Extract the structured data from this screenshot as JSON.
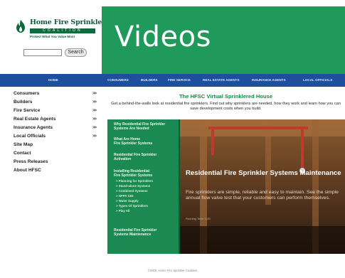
{
  "logo": {
    "title": "Home Fire Sprinkler",
    "coalition": "COALITION",
    "tagline": "Protect What You Value Most"
  },
  "search": {
    "placeholder": "",
    "button_label": "Search"
  },
  "header": {
    "title": "Videos"
  },
  "nav": {
    "items": [
      "HOME",
      "CONSUMERS",
      "BUILDERS",
      "FIRE SERVICE",
      "REAL ESTATE AGENTS",
      "INSURANCE AGENTS",
      "LOCAL OFFICIALS"
    ]
  },
  "sidebar": {
    "arrow": ">>",
    "items": [
      {
        "label": "Consumers"
      },
      {
        "label": "Builders"
      },
      {
        "label": "Fire Service"
      },
      {
        "label": "Real Estate Agents"
      },
      {
        "label": "Insurance Agents"
      },
      {
        "label": "Local Officials"
      },
      {
        "label": "Site Map"
      },
      {
        "label": "Contact"
      },
      {
        "label": "Press Releases"
      },
      {
        "label": "About HFSC"
      }
    ]
  },
  "main": {
    "title": "The HFSC Virtual Sprinklered House",
    "intro": "Get a behind-the-walls look at residential fire sprinklers. Find out why sprinklers are needed, how they work and learn how you can save development costs when you build."
  },
  "chapters": {
    "items": [
      "Why Residential Fire Sprinkler",
      "Systems Are Needed",
      "What Are Home",
      "Fire Sprinkler Systems",
      "Residential Fire Sprinkler",
      "Activation",
      "Installing Residential",
      "Fire Sprinkler Systems",
      "Residential Fire Sprinkler",
      "Systems Maintenance"
    ],
    "sub_items": [
      "> Planning for Sprinklers",
      "> Stand-alone Systems",
      "> Combined Systems",
      "> NFPA 13D",
      "> Water Supply",
      "> Types Of Sprinklers",
      "> Play All"
    ]
  },
  "video": {
    "heading": "Residential Fire Sprinkler Systems Maintenance",
    "description": "Fire sprinklers are simple, reliable and easy to maintain. See the simple annual flow valve test that your customers can perform themselves.",
    "meta": "Running Time: 1:00"
  },
  "footer": {
    "text": "©2008, Home Fire Sprinkler Coalition"
  },
  "colors": {
    "green": "#1f9a5a",
    "dark_green": "#0f5c3c",
    "nav_blue": "#1d4f9e",
    "title_green": "#108a45"
  }
}
